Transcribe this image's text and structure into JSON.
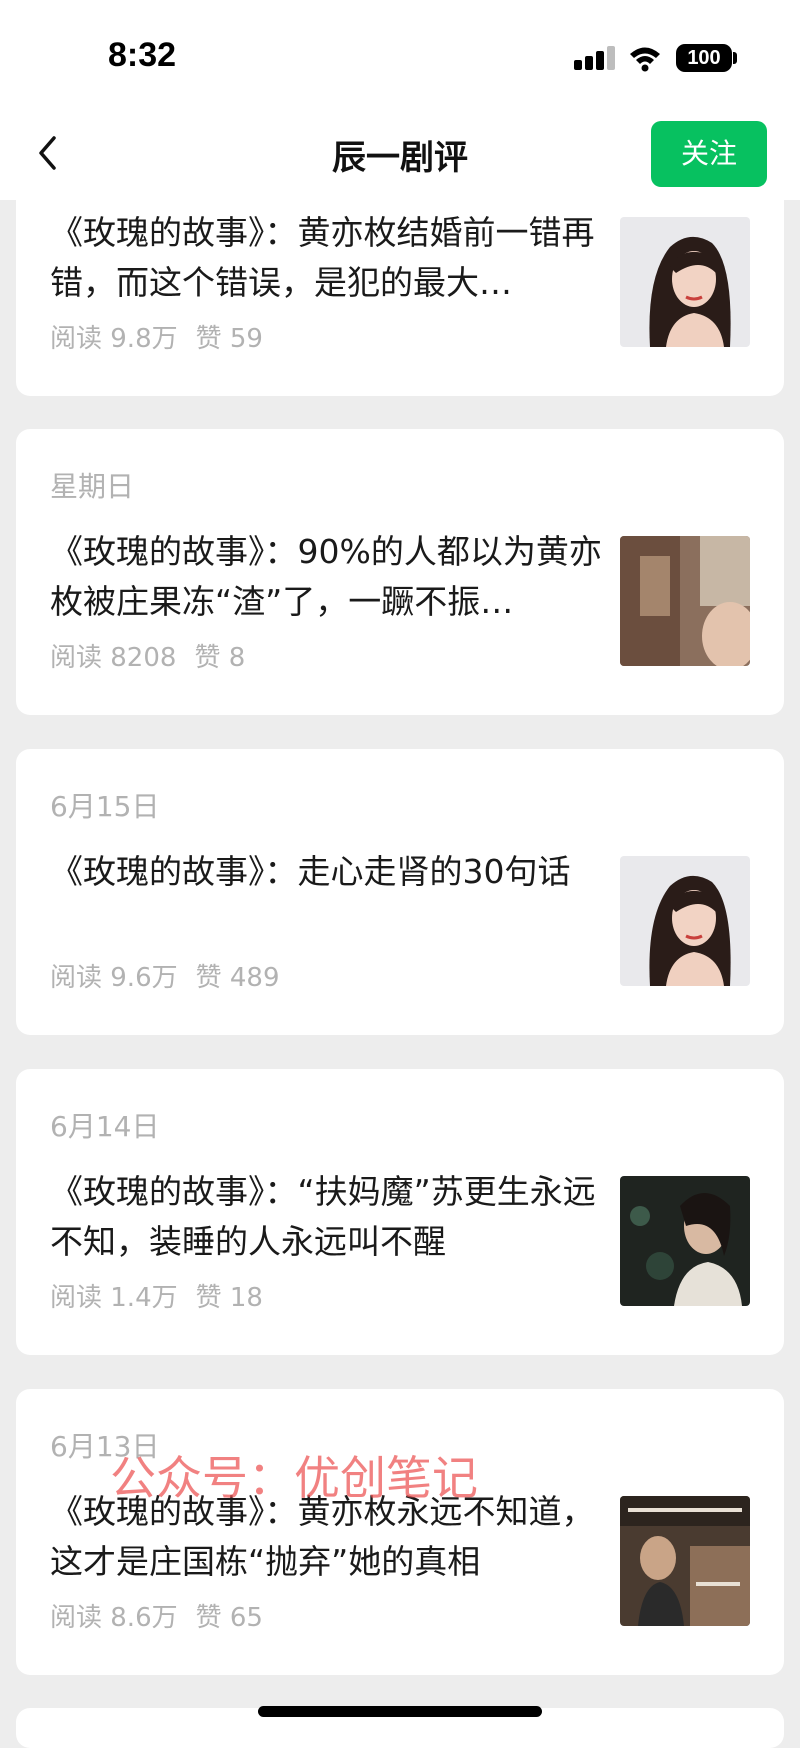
{
  "status_bar": {
    "time": "8:32",
    "battery": "100"
  },
  "header": {
    "title": "辰一剧评",
    "follow_label": "关注"
  },
  "articles": [
    {
      "date": "",
      "title": "《玫瑰的故事》：黄亦枚结婚前一错再错，而这个错误，是犯的最大…",
      "reads": "阅读 9.8万",
      "likes": "赞 59"
    },
    {
      "date": "星期日",
      "title": "《玫瑰的故事》：90%的人都以为黄亦枚被庄果冻“渣”了，一蹶不振…",
      "reads": "阅读 8208",
      "likes": "赞 8"
    },
    {
      "date": "6月15日",
      "title": "《玫瑰的故事》：走心走肾的30句话",
      "reads": "阅读 9.6万",
      "likes": "赞 489"
    },
    {
      "date": "6月14日",
      "title": "《玫瑰的故事》：“扶妈魔”苏更生永远不知，装睡的人永远叫不醒",
      "reads": "阅读 1.4万",
      "likes": "赞 18"
    },
    {
      "date": "6月13日",
      "title": "《玫瑰的故事》：黄亦枚永远不知道，这才是庄国栋“抛弃”她的真相",
      "reads": "阅读 8.6万",
      "likes": "赞 65"
    }
  ],
  "watermark": "公众号：优创笔记",
  "colors": {
    "accent": "#07c160",
    "background": "#ededed",
    "meta": "#b2b2b2"
  },
  "icons": [
    "back-arrow-icon",
    "signal-icon",
    "wifi-icon",
    "battery-icon"
  ]
}
